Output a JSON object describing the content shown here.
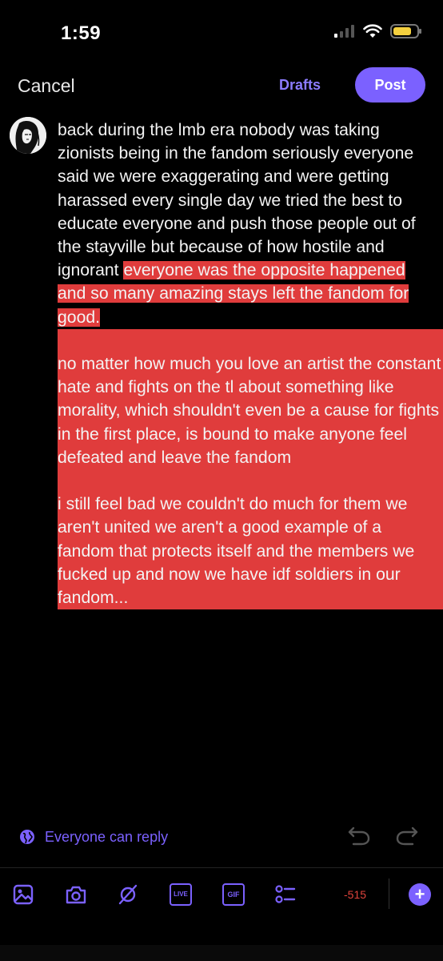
{
  "status_bar": {
    "time": "1:59",
    "battery_color": "#f4d03f"
  },
  "topbar": {
    "cancel_label": "Cancel",
    "drafts_label": "Drafts",
    "post_label": "Post"
  },
  "compose": {
    "para1_before_selection": "back during the lmb era nobody was taking zionists being in the fandom seriously everyone said we were exaggerating and were getting harassed every single day we tried the best to educate everyone and push those people out of the stayville but because of how hostile and ignorant",
    "para1_selected": "everyone was the opposite happened and so many amazing stays left the fandom for good.",
    "para2": "no matter how much you love an artist the constant hate and fights on the tl about something like morality, which shouldn't even be a cause for fights in the first place, is bound to make anyone feel defeated and leave the fandom",
    "para3": "i still feel bad we couldn't do much for them we aren't united we aren't a good example of a fandom that protects itself and the members we fucked up and now we have idf soldiers in our fandom...",
    "selection_color": "#e03c3c"
  },
  "reply_setting": {
    "label": "Everyone can reply",
    "accent": "#7b61ff"
  },
  "toolbar": {
    "items": [
      "image-icon",
      "camera-icon",
      "gif-search-icon",
      "live-icon",
      "gif-icon",
      "poll-icon"
    ],
    "live_label": "LIVE",
    "gif_label": "GIF",
    "char_counter": "-515",
    "counter_color": "#e0443c",
    "add_label": "+"
  }
}
